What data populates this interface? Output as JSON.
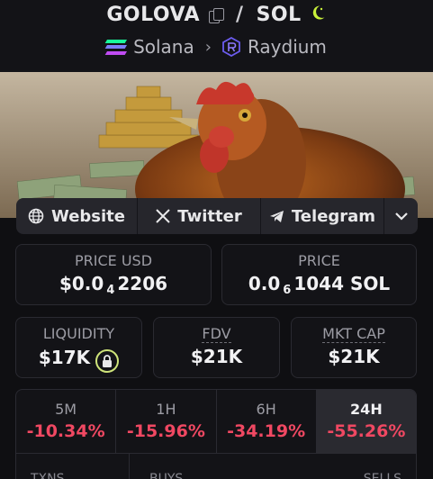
{
  "header": {
    "token": "GOLOVA",
    "separator": "/",
    "quote": "SOL",
    "chain": "Solana",
    "dex": "Raydium"
  },
  "links": {
    "website": "Website",
    "twitter": "Twitter",
    "telegram": "Telegram"
  },
  "price_usd": {
    "label": "PRICE USD",
    "prefix": "$0.0",
    "zeros": "4",
    "digits": "2206"
  },
  "price_native": {
    "label": "PRICE",
    "prefix": "0.0",
    "zeros": "6",
    "digits": "1044 SOL"
  },
  "liquidity": {
    "label": "LIQUIDITY",
    "value": "$17K"
  },
  "fdv": {
    "label": "FDV",
    "value": "$21K"
  },
  "mkt_cap": {
    "label": "MKT CAP",
    "value": "$21K"
  },
  "changes": [
    {
      "period": "5M",
      "value": "-10.34%"
    },
    {
      "period": "1H",
      "value": "-15.96%"
    },
    {
      "period": "6H",
      "value": "-34.19%"
    },
    {
      "period": "24H",
      "value": "-55.26%",
      "active": true
    }
  ],
  "stats": {
    "txns": "TXNS",
    "buys": "BUYS",
    "sells": "SELLS"
  },
  "colors": {
    "negative": "#f04862",
    "accent": "#c8f03a",
    "background": "#0f0f12"
  },
  "icons": [
    "copy-icon",
    "moon-icon",
    "solana-icon",
    "chevron-right-icon",
    "raydium-icon",
    "globe-icon",
    "x-icon",
    "telegram-icon",
    "chevron-down-icon",
    "lock-icon"
  ]
}
